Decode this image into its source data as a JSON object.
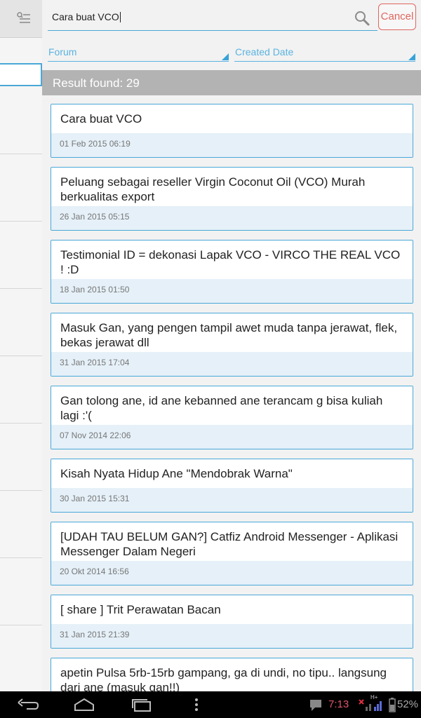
{
  "search": {
    "query": "Cara buat VCO",
    "cancel_label": "Cancel"
  },
  "filters": {
    "forum_label": "Forum",
    "date_label": "Created Date"
  },
  "result_label": "Result found: 29",
  "results": [
    {
      "title": "Cara buat VCO",
      "date": "01 Feb 2015 06:19"
    },
    {
      "title": "Peluang sebagai reseller Virgin Coconut Oil (VCO) Murah berkualitas export",
      "date": "26 Jan 2015 05:15"
    },
    {
      "title": "Testimonial ID = dekonasi Lapak VCO - VIRCO THE REAL VCO ! :D",
      "date": "18 Jan 2015 01:50"
    },
    {
      "title": "Masuk Gan, yang pengen tampil awet muda tanpa jerawat, flek, bekas jerawat dll",
      "date": "31 Jan 2015 17:04"
    },
    {
      "title": "Gan tolong ane, id ane kebanned ane terancam g bisa kuliah lagi :'(",
      "date": "07 Nov 2014 22:06"
    },
    {
      "title": "Kisah Nyata Hidup Ane \"Mendobrak Warna\"",
      "date": "30 Jan 2015 15:31"
    },
    {
      "title": "[UDAH TAU BELUM GAN?] Catfiz Android Messenger - Aplikasi Messenger Dalam Negeri",
      "date": "20 Okt 2014 16:56"
    },
    {
      "title": "[ share ] Trit Perawatan Bacan",
      "date": "31 Jan 2015 21:39"
    },
    {
      "title": "apetin Pulsa 5rb-15rb gampang, ga di undi, no tipu.. langsung dari ane (masuk gan!!)",
      "date": ""
    }
  ],
  "status_bar": {
    "time": "7:13",
    "battery": "52%",
    "network": "H+"
  },
  "icons": [
    "menu-filter-icon",
    "search-icon",
    "back-icon",
    "home-icon",
    "recent-apps-icon",
    "overflow-menu-icon",
    "chat-icon",
    "signal-icon",
    "battery-icon"
  ]
}
